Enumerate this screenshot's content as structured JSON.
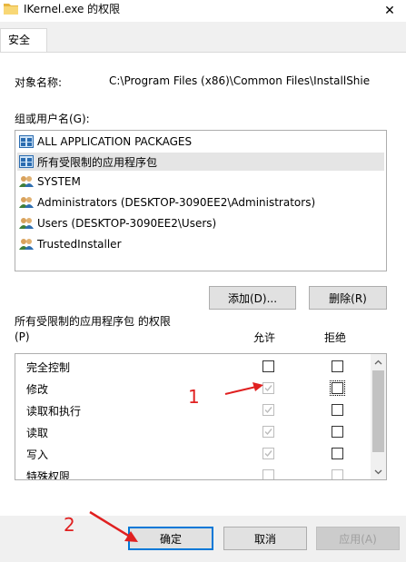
{
  "window": {
    "title": "IKernel.exe 的权限",
    "close_glyph": "✕"
  },
  "tabs": [
    {
      "label": "安全"
    }
  ],
  "object": {
    "label": "对象名称:",
    "value": "C:\\Program Files (x86)\\Common Files\\InstallShie"
  },
  "groups": {
    "label": "组或用户名(G):",
    "items": [
      {
        "label": "ALL APPLICATION PACKAGES",
        "icon": "package-icon"
      },
      {
        "label": "所有受限制的应用程序包",
        "icon": "package-icon"
      },
      {
        "label": "SYSTEM",
        "icon": "users-icon"
      },
      {
        "label": "Administrators (DESKTOP-3090EE2\\Administrators)",
        "icon": "users-icon"
      },
      {
        "label": "Users (DESKTOP-3090EE2\\Users)",
        "icon": "users-icon"
      },
      {
        "label": "TrustedInstaller",
        "icon": "users-icon"
      }
    ],
    "selected_index": 1
  },
  "buttons": {
    "add": "添加(D)...",
    "remove": "删除(R)"
  },
  "permissions": {
    "label_line1": "所有受限制的应用程序包 的权限",
    "label_line2": "(P)",
    "allow_header": "允许",
    "deny_header": "拒绝",
    "rows": [
      {
        "name": "完全控制",
        "allow": false,
        "allow_disabled": false,
        "deny": false
      },
      {
        "name": "修改",
        "allow": true,
        "allow_disabled": true,
        "deny": false
      },
      {
        "name": "读取和执行",
        "allow": true,
        "allow_disabled": true,
        "deny": false
      },
      {
        "name": "读取",
        "allow": true,
        "allow_disabled": true,
        "deny": false
      },
      {
        "name": "写入",
        "allow": true,
        "allow_disabled": true,
        "deny": false
      },
      {
        "name": "特殊权限",
        "allow": false,
        "allow_disabled": true,
        "deny": false
      }
    ]
  },
  "footer": {
    "ok": "确定",
    "cancel": "取消",
    "apply": "应用(A)"
  },
  "annotations": {
    "marker_1": "1",
    "marker_2": "2"
  },
  "colors": {
    "annotation": "#e02020",
    "focus_border": "#0078d7"
  }
}
